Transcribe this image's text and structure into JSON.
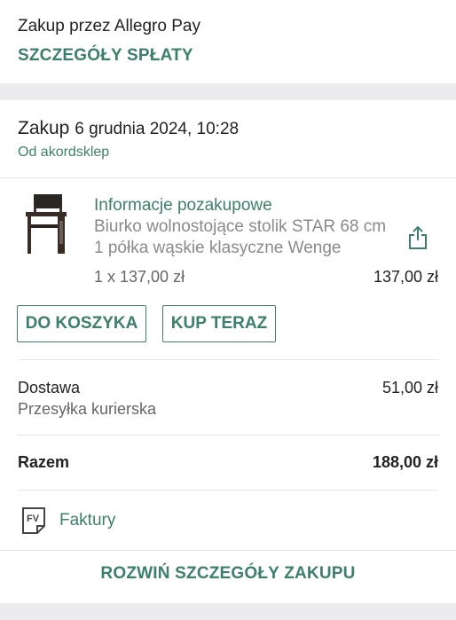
{
  "header": {
    "title": "Zakup przez Allegro Pay",
    "details_link": "SZCZEGÓŁY SPŁATY"
  },
  "purchase": {
    "label": "Zakup",
    "date": "6 grudnia 2024, 10:28",
    "seller_prefix": "Od",
    "seller_name": "akordsklep"
  },
  "item": {
    "info_link": "Informacje pozakupowe",
    "name_line1": "Biurko wolnostojące stolik STAR 68 cm",
    "name_line2": "1 półka wąskie klasyczne Wenge",
    "quantity_price": "1 x 137,00 zł",
    "total": "137,00 zł",
    "image_icon": "desk-product-icon",
    "share_icon": "share-icon"
  },
  "actions": {
    "add_to_cart": "DO KOSZYKA",
    "buy_now": "KUP TERAZ"
  },
  "delivery": {
    "label": "Dostawa",
    "method": "Przesyłka kurierska",
    "price": "51,00 zł"
  },
  "summary": {
    "label": "Razem",
    "total": "188,00 zł"
  },
  "invoices": {
    "icon": "invoice-fv-icon",
    "label": "Faktury"
  },
  "footer": {
    "expand_link": "ROZWIŃ SZCZEGÓŁY ZAKUPU"
  },
  "colors": {
    "accent": "#3c7f6a",
    "separator": "#ececee"
  }
}
